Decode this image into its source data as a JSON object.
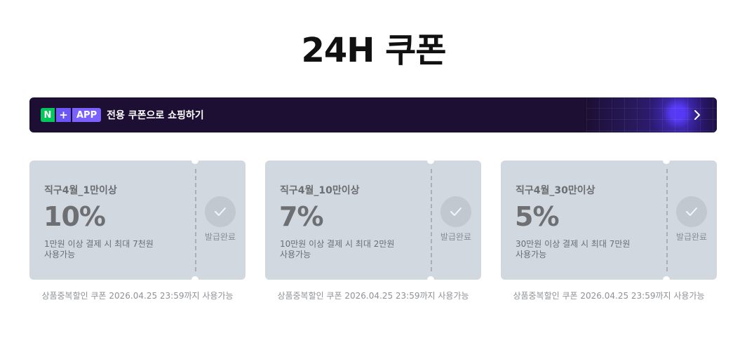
{
  "page": {
    "title": "24H 쿠폰"
  },
  "banner": {
    "badge_n": "N",
    "badge_plus": "+",
    "badge_app": "APP",
    "text": "전용 쿠폰으로 쇼핑하기",
    "arrow_icon": "chevron-right-icon"
  },
  "coupons": [
    {
      "name": "직구4월_1만이상",
      "rate": "10%",
      "desc_line1": "1만원 이상 결제 시 최대 7천원",
      "desc_line2": "사용가능",
      "status": "발급완료",
      "validity": "상품중복할인 쿠폰 2026.04.25 23:59까지 사용가능"
    },
    {
      "name": "직구4월_10만이상",
      "rate": "7%",
      "desc_line1": "10만원 이상 결제 시 최대 2만원",
      "desc_line2": "사용가능",
      "status": "발급완료",
      "validity": "상품중복할인 쿠폰 2026.04.25 23:59까지 사용가능"
    },
    {
      "name": "직구4월_30만이상",
      "rate": "5%",
      "desc_line1": "30만원 이상 결제 시 최대 7만원",
      "desc_line2": "사용가능",
      "status": "발급완료",
      "validity": "상품중복할인 쿠폰 2026.04.25 23:59까지 사용가능"
    }
  ],
  "colors": {
    "banner_bg": "#1c0f33",
    "naver_green": "#03c75a",
    "accent_purple": "#7b61ff",
    "coupon_bg": "#d2d8df"
  }
}
